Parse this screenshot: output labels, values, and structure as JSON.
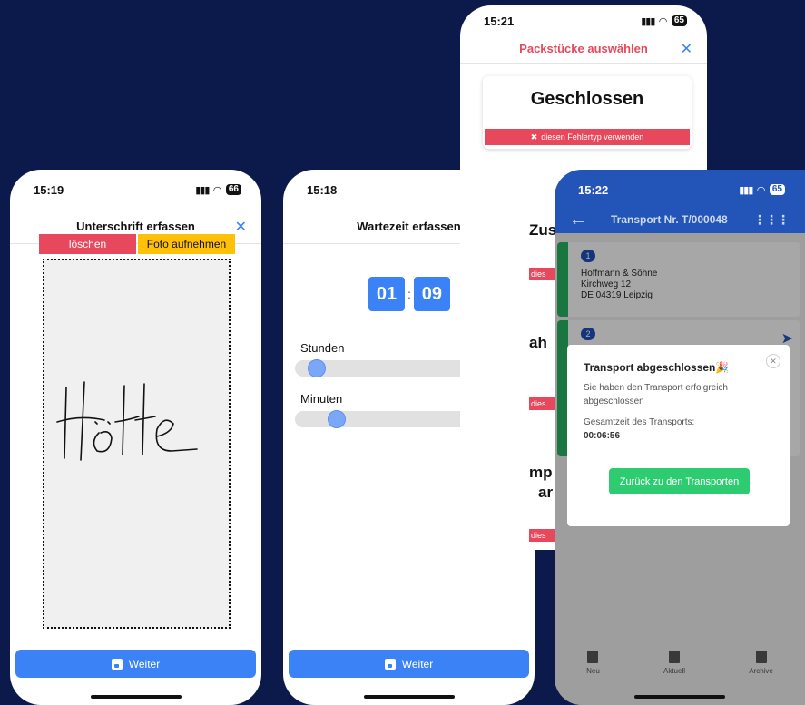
{
  "signature": {
    "time": "15:19",
    "battery": "66",
    "title": "Unterschrift erfassen",
    "close": "✕",
    "delete_label": "löschen",
    "photo_label": "Foto aufnehmen",
    "signature_text": "Hölle",
    "next_label": "Weiter"
  },
  "waittime": {
    "time": "15:18",
    "battery": "66",
    "title": "Wartezeit erfassen",
    "close": "✕",
    "hours": "01",
    "minutes": "09",
    "hours_label": "Stunden",
    "minutes_label": "Minuten",
    "hours_slider_value": 0.06,
    "minutes_slider_value": 0.16,
    "next_label": "Weiter"
  },
  "packages": {
    "time": "15:21",
    "battery": "65",
    "title": "Packstücke auswählen",
    "close": "✕",
    "card_title": "Geschlossen",
    "error_button": "diesen Fehlertyp verwenden",
    "peek_items": [
      "Zus",
      "ah",
      "mp",
      "ar"
    ],
    "peek_button": "dies"
  },
  "transport": {
    "time": "15:22",
    "battery": "65",
    "title": "Transport Nr. T/000048",
    "stops": [
      {
        "number": "1",
        "line1": "Hoffmann & Söhne",
        "line2": "Kirchweg 12",
        "line3": "DE 04319 Leipzig"
      },
      {
        "number": "2"
      }
    ],
    "modal": {
      "title": "Transport abgeschlossen",
      "emoji": "🎉",
      "description": "Sie haben den Transport erfolgreich abgeschlossen",
      "total_label": "Gesamtzeit des Transports:",
      "total_value": "00:06:56",
      "button": "Zurück zu den Transporten"
    },
    "nav": [
      "Neu",
      "Aktuell",
      "Archive"
    ]
  },
  "colors": {
    "background": "#0b1a4a",
    "primary": "#3b82f6",
    "danger": "#e8485c",
    "warning": "#ffc107",
    "success": "#2ecc71",
    "header": "#2354b8"
  }
}
